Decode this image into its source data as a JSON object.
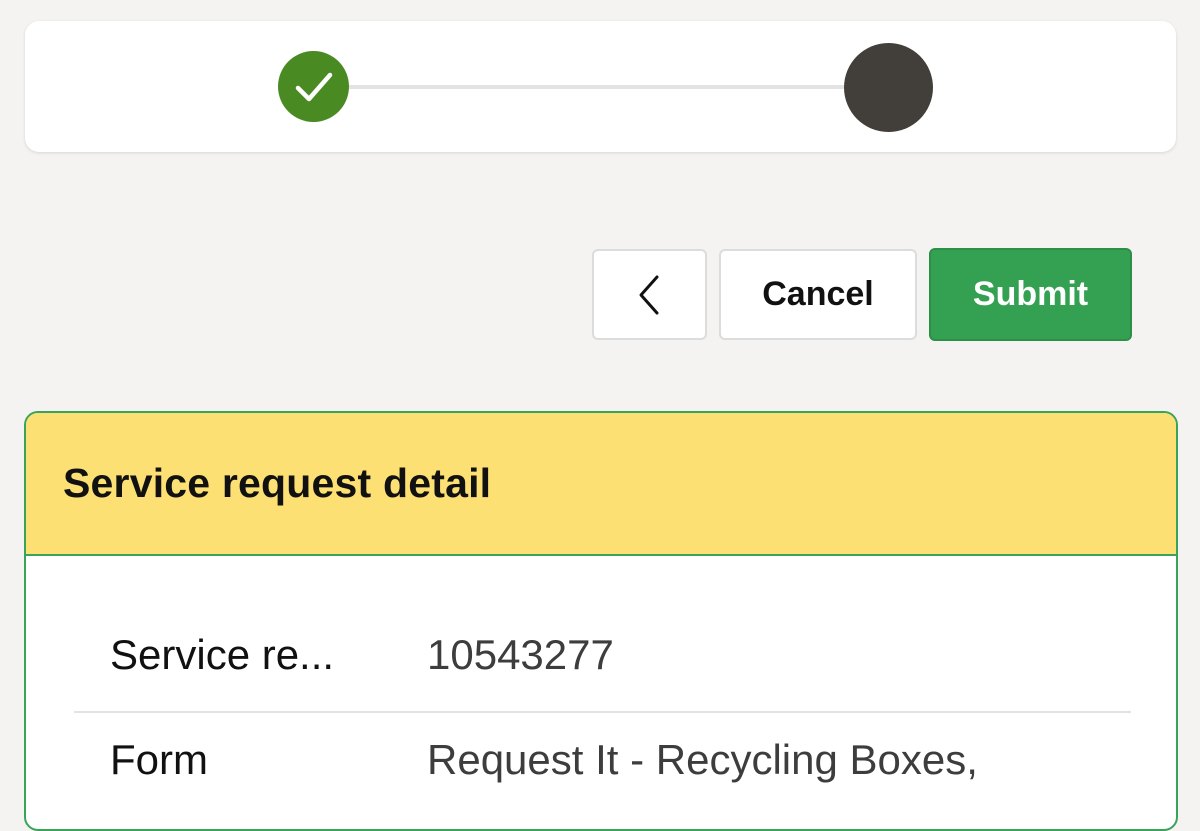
{
  "colors": {
    "page_background": "#f4f3f1",
    "step_complete": "#4a8a23",
    "step_current": "#423e39",
    "submit_background": "#34a152",
    "detail_header_background": "#fde073",
    "detail_border": "#3aa35a"
  },
  "stepper": {
    "steps": [
      {
        "state": "complete",
        "icon": "checkmark-icon"
      },
      {
        "state": "current",
        "icon": ""
      }
    ]
  },
  "actions": {
    "back_icon": "chevron-left-icon",
    "cancel_label": "Cancel",
    "submit_label": "Submit"
  },
  "detail": {
    "title": "Service request detail",
    "rows": [
      {
        "label": "Service re...",
        "value": "10543277"
      },
      {
        "label": "Form",
        "value": "Request It - Recycling Boxes,"
      }
    ]
  }
}
